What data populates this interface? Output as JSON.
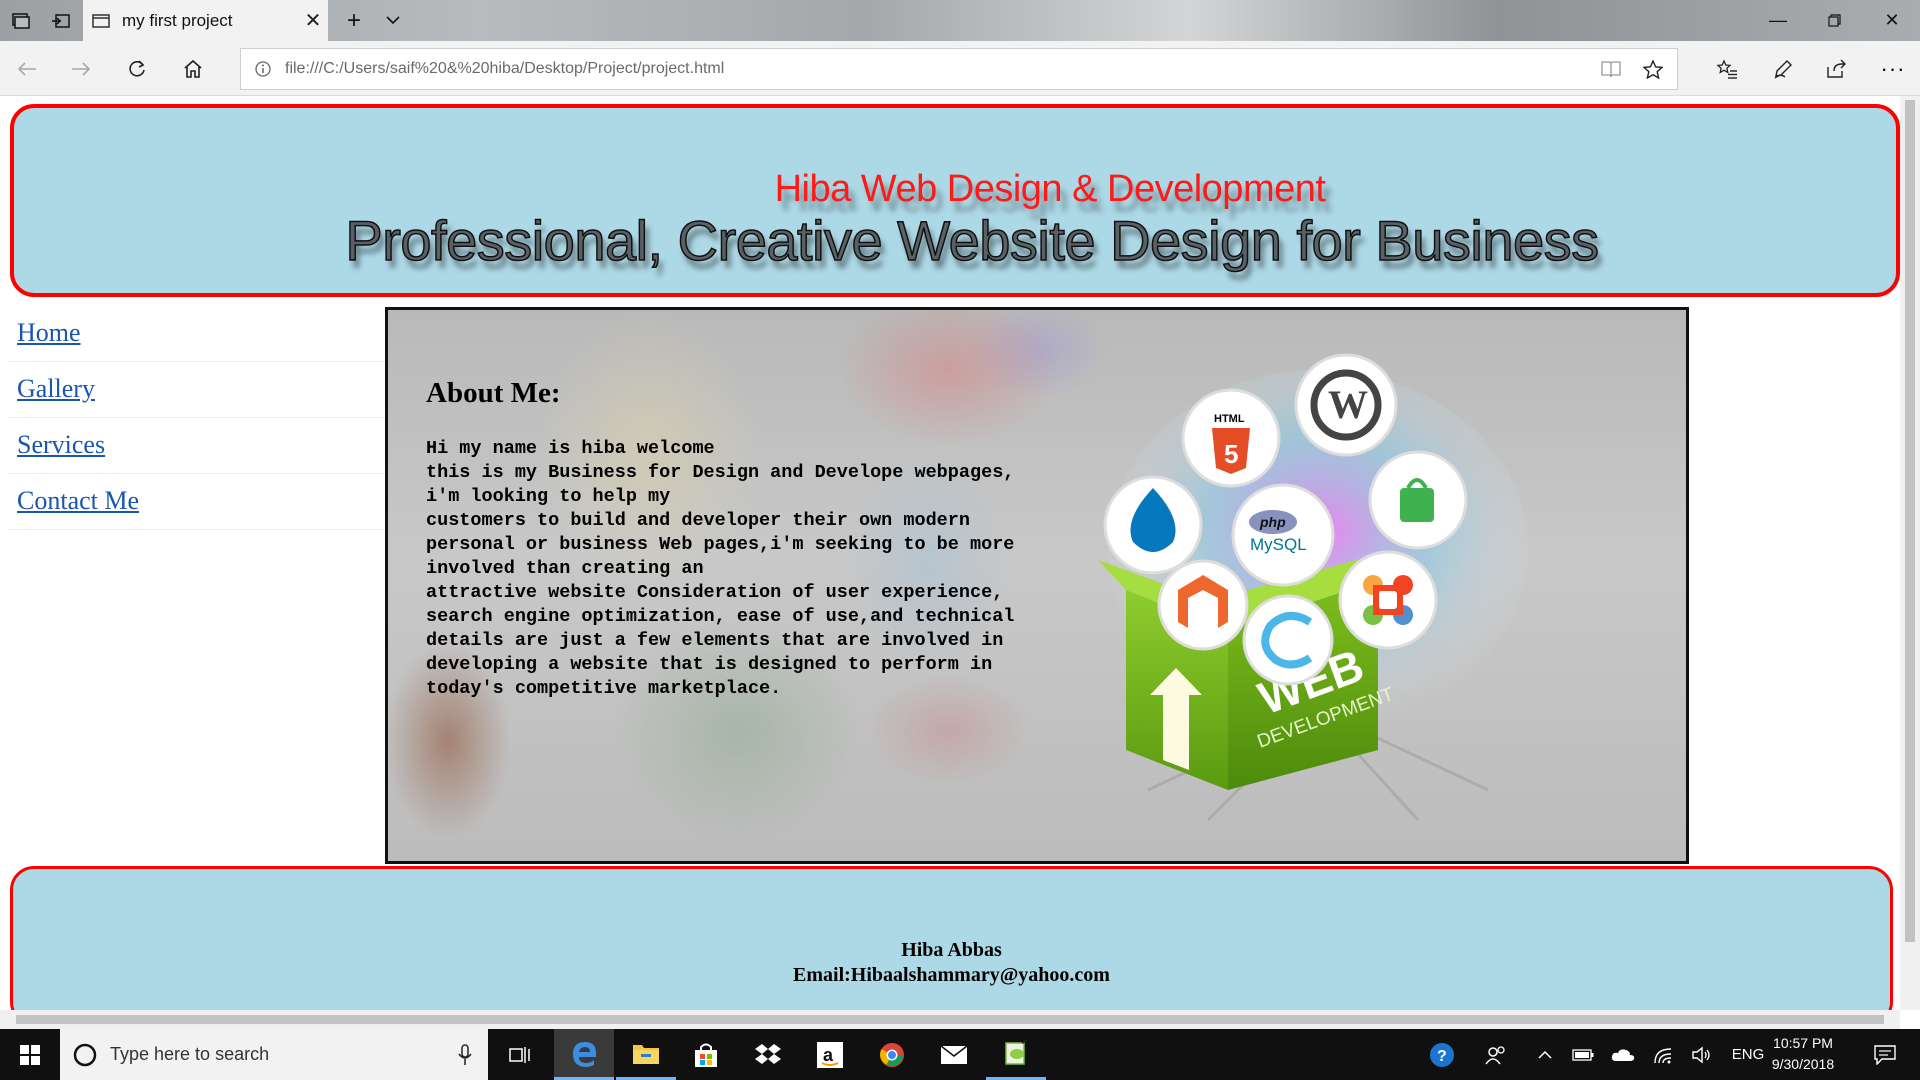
{
  "browser": {
    "tab_title": "my first project",
    "url": "file:///C:/Users/saif%20&%20hiba/Desktop/Project/project.html"
  },
  "page": {
    "header": {
      "site_name": "Hiba Web Design & Development",
      "tagline": "Professional, Creative Website Design for Business"
    },
    "nav": {
      "items": [
        {
          "label": "Home"
        },
        {
          "label": "Gallery"
        },
        {
          "label": "Services"
        },
        {
          "label": "Contact Me"
        }
      ]
    },
    "about": {
      "heading": "About Me:",
      "bio": "Hi my name is hiba welcome\nthis is my Business for Design and Develope webpages,\ni'm looking to help my\ncustomers to build and developer their own modern\npersonal or business Web pages,i'm seeking to be more\ninvolved than creating an\nattractive website Consideration of user experience,\nsearch engine optimization, ease of use,and technical\ndetails are just a few elements that are involved in\ndeveloping a website that is designed to perform in\ntoday's competitive marketplace.",
      "image": {
        "box_text_big": "WEB",
        "box_text_small": "DEVELOPMENT",
        "badges": [
          "HTML",
          "php",
          "MySQL"
        ]
      }
    },
    "footer": {
      "name": "Hiba Abbas",
      "email": "Email:Hibaalshammary@yahoo.com"
    }
  },
  "taskbar": {
    "search_placeholder": "Type here to search",
    "language": "ENG",
    "time": "10:57 PM",
    "date": "9/30/2018"
  },
  "colors": {
    "header_bg": "#add8e6",
    "border_red": "#ff0000",
    "site_name_red": "#ff1a1a",
    "link_blue": "#1a55b0"
  }
}
